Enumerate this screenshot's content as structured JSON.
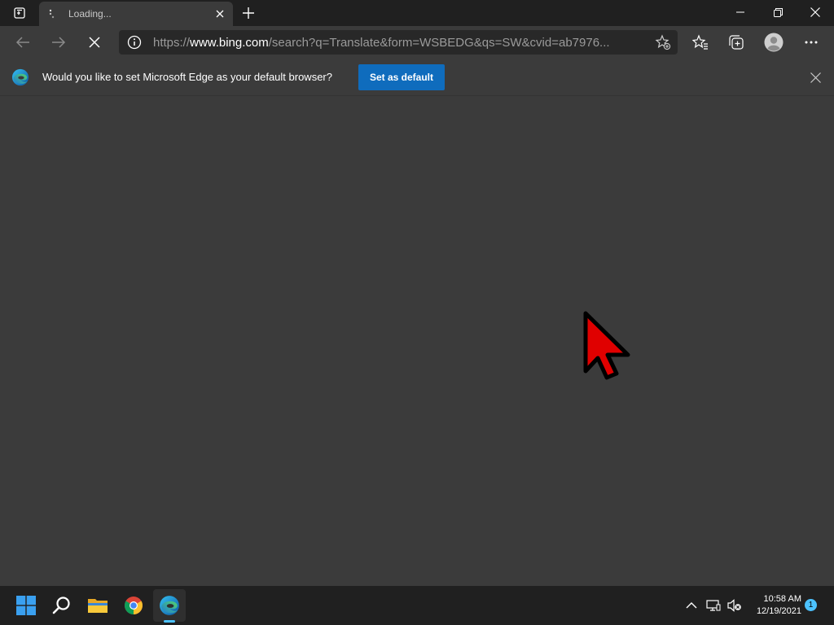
{
  "tab": {
    "title": "Loading..."
  },
  "address_bar": {
    "url_prefix": "https://",
    "url_host": "www.bing.com",
    "url_rest": "/search?q=Translate&form=WSBEDG&qs=SW&cvid=ab7976..."
  },
  "infobar": {
    "message": "Would you like to set Microsoft Edge as your default browser?",
    "button_label": "Set as default"
  },
  "taskbar": {
    "time": "10:58 AM",
    "date": "12/19/2021",
    "notification_count": "1"
  },
  "colors": {
    "accent": "#0f6cbd",
    "cursor": "#e00000",
    "taskbar_indicator": "#4cc2ff"
  }
}
